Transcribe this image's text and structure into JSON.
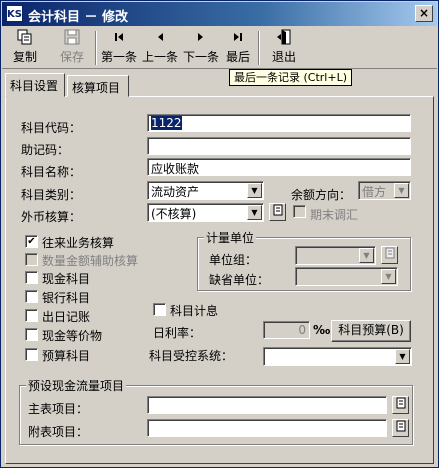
{
  "window": {
    "logo": "KS",
    "title": "会计科目 － 修改",
    "close_glyph": "×"
  },
  "toolbar": {
    "copy": "复制",
    "save": "保存",
    "first": "第一条",
    "prev": "上一条",
    "next": "下一条",
    "last": "最后",
    "exit": "退出"
  },
  "tooltip": "最后一条记录 (Ctrl+L)",
  "tabs": [
    {
      "label": "科目设置"
    },
    {
      "label": "核算项目"
    }
  ],
  "form": {
    "code_label": "科目代码：",
    "code_value": "1122",
    "mnemonic_label": "助记码：",
    "mnemonic_value": "",
    "name_label": "科目名称：",
    "name_value": "应收账款",
    "category_label": "科目类别：",
    "category_value": "流动资产",
    "balance_dir_label": "余额方向：",
    "balance_dir_value": "借方",
    "currency_label": "外币核算：",
    "currency_value": "(不核算)",
    "period_end_label": "期末调汇"
  },
  "checks": [
    {
      "label": "往来业务核算",
      "checked": true,
      "disabled": false
    },
    {
      "label": "数量金额辅助核算",
      "checked": false,
      "disabled": true
    },
    {
      "label": "现金科目",
      "checked": false,
      "disabled": false
    },
    {
      "label": "银行科目",
      "checked": false,
      "disabled": false
    },
    {
      "label": "出日记账",
      "checked": false,
      "disabled": false
    },
    {
      "label": "现金等价物",
      "checked": false,
      "disabled": false
    },
    {
      "label": "预算科目",
      "checked": false,
      "disabled": false
    }
  ],
  "unit_group": {
    "title": "计量单位",
    "group_label": "单位组：",
    "default_label": "缺省单位："
  },
  "interest": {
    "accrue_label": "科目计息",
    "rate_label": "日利率：",
    "rate_value": "0",
    "rate_unit": "‰",
    "budget_button": "科目预算(B)",
    "control_label": "科目受控系统："
  },
  "cashflow": {
    "title": "预设现金流量项目",
    "main_label": "主表项目：",
    "sub_label": "附表项目："
  }
}
